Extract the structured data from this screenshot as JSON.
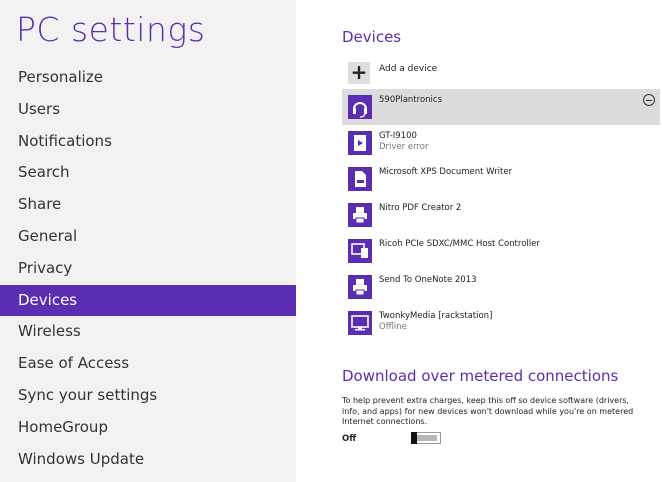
{
  "app_title": "PC settings",
  "nav": [
    {
      "label": "Personalize"
    },
    {
      "label": "Users"
    },
    {
      "label": "Notifications"
    },
    {
      "label": "Search"
    },
    {
      "label": "Share"
    },
    {
      "label": "General"
    },
    {
      "label": "Privacy"
    },
    {
      "label": "Devices",
      "selected": true
    },
    {
      "label": "Wireless"
    },
    {
      "label": "Ease of Access"
    },
    {
      "label": "Sync your settings"
    },
    {
      "label": "HomeGroup"
    },
    {
      "label": "Windows Update"
    }
  ],
  "devices": {
    "title": "Devices",
    "add_label": "Add a device",
    "add_icon": "plus-icon",
    "items": [
      {
        "name": "590Plantronics",
        "status": "",
        "icon": "headset-icon",
        "selected": true
      },
      {
        "name": "GT-I9100",
        "status": "Driver error",
        "icon": "media-player-icon"
      },
      {
        "name": "Microsoft XPS Document Writer",
        "status": "",
        "icon": "document-icon"
      },
      {
        "name": "Nitro PDF Creator 2",
        "status": "",
        "icon": "printer-icon"
      },
      {
        "name": "Ricoh PCIe SDXC/MMC Host Controller",
        "status": "",
        "icon": "device-icon"
      },
      {
        "name": "Send To OneNote 2013",
        "status": "",
        "icon": "printer-icon"
      },
      {
        "name": "TwonkyMedia [rackstation]",
        "status": "Offline",
        "icon": "monitor-icon"
      }
    ]
  },
  "metered": {
    "title": "Download over metered connections",
    "description": "To help prevent extra charges, keep this off so device software (drivers, info, and apps) for new devices won't download while you're on metered Internet connections.",
    "toggle_label": "Off",
    "toggle_on": false
  },
  "colors": {
    "accent": "#5b2db3",
    "left_panel": "#f2f2f2",
    "selected_row": "#dcdcdc"
  }
}
